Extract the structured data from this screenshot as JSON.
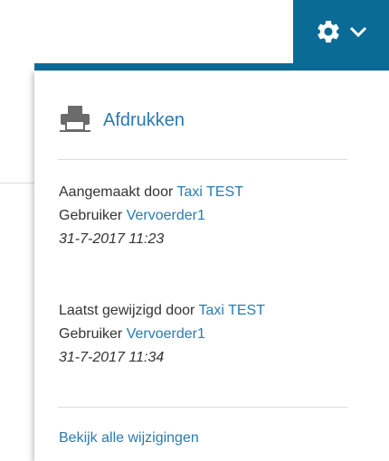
{
  "toolbar": {
    "settings_icon": "gear-icon",
    "dropdown_icon": "chevron-down-icon",
    "accent_color": "#0a6b97"
  },
  "menu": {
    "print_label": "Afdrukken",
    "created": {
      "by_prefix": "Aangemaakt door",
      "by_user": "Taxi TEST",
      "user_prefix": "Gebruiker",
      "user_name": "Vervoerder1",
      "date": "31-7-2017 11:23"
    },
    "modified": {
      "by_prefix": "Laatst gewijzigd door",
      "by_user": "Taxi TEST",
      "user_prefix": "Gebruiker",
      "user_name": "Vervoerder1",
      "date": "31-7-2017 11:34"
    },
    "view_all_label": "Bekijk alle wijzigingen",
    "link_color": "#2a7aaf"
  }
}
